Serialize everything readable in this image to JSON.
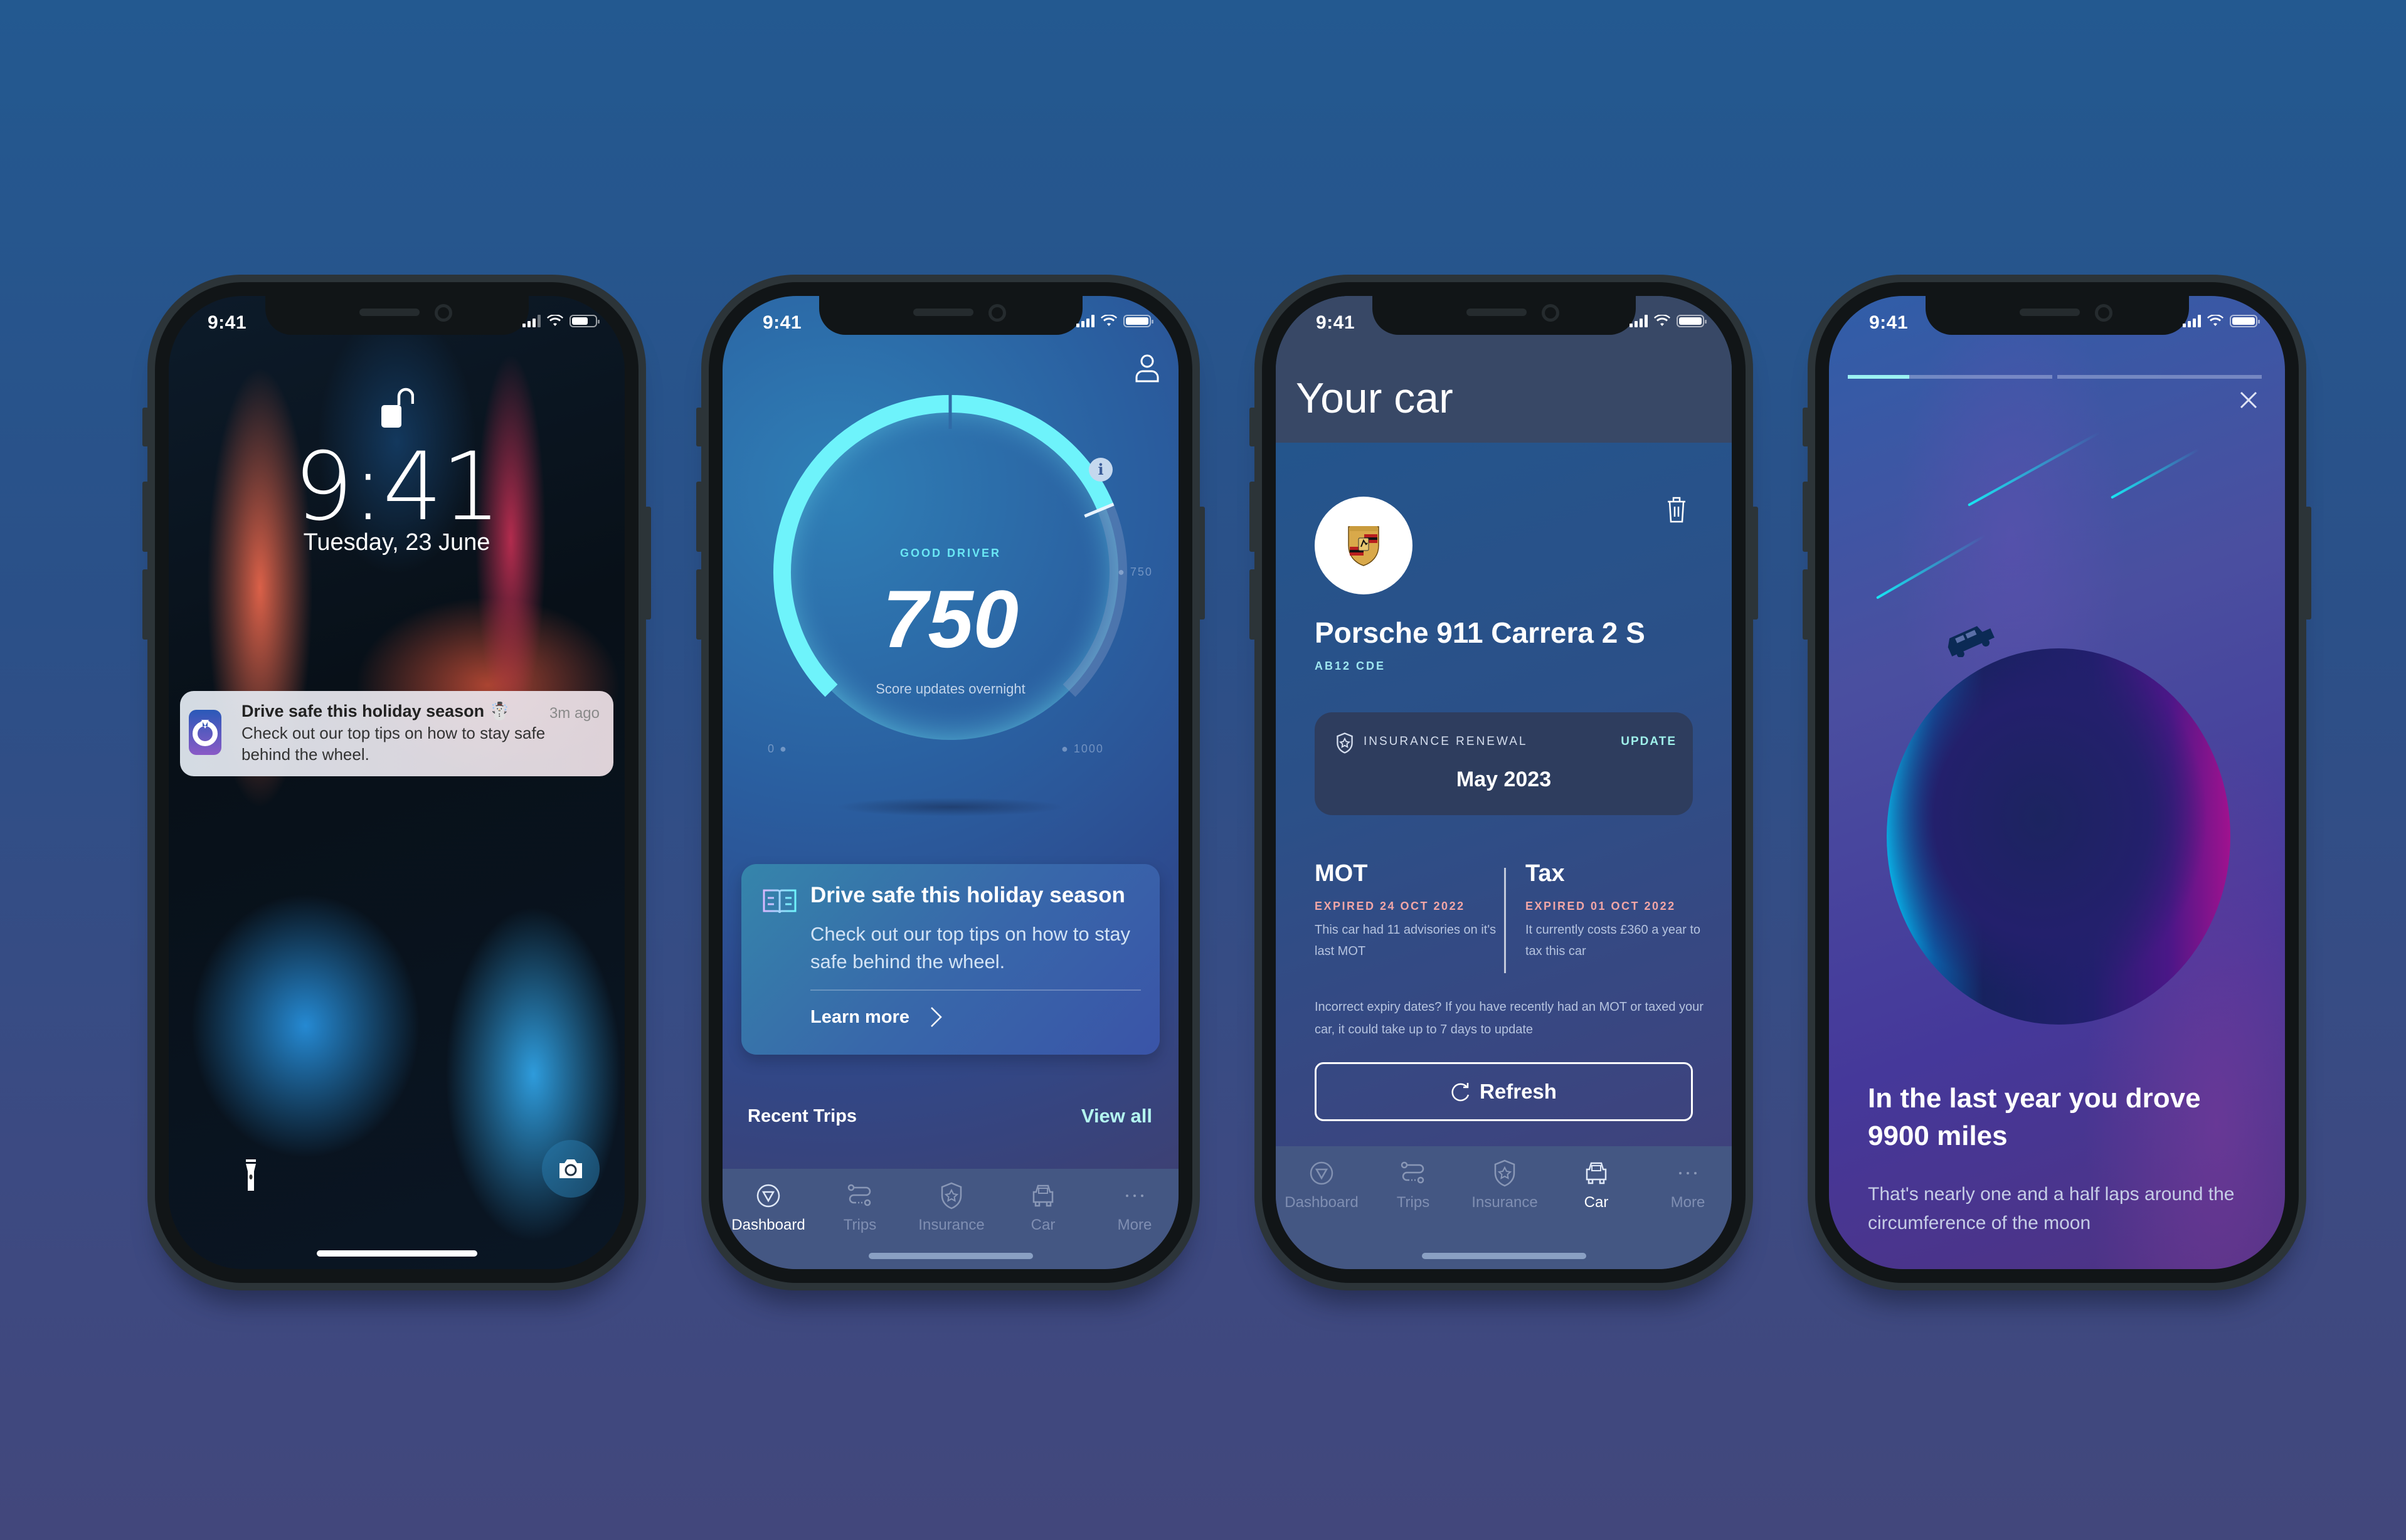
{
  "status_bar": {
    "time": "9:41"
  },
  "lock_screen": {
    "time": "9:41",
    "date": "Tuesday, 23 June",
    "notification": {
      "title": "Drive safe this holiday season ☃️",
      "time_ago": "3m ago",
      "body": "Check out our top tips on how to stay safe behind the wheel."
    },
    "icons": [
      "unlock-icon",
      "flashlight-icon",
      "camera-icon"
    ]
  },
  "dashboard": {
    "score_label": "GOOD DRIVER",
    "score": "750",
    "score_sub": "Score updates overnight",
    "gauge": {
      "min": 0,
      "max": 1000,
      "value": 750,
      "min_label": "0",
      "max_label": "1000",
      "value_label": "750"
    },
    "tip_card": {
      "title": "Drive safe this holiday season",
      "body": "Check out our top tips on how to stay safe behind the wheel.",
      "link": "Learn more"
    },
    "recent_trips": "Recent Trips",
    "view_all": "View all",
    "accent": "#6ef3fb"
  },
  "tabs": [
    {
      "label": "Dashboard",
      "icon": "dashboard-icon"
    },
    {
      "label": "Trips",
      "icon": "trips-icon"
    },
    {
      "label": "Insurance",
      "icon": "insurance-icon"
    },
    {
      "label": "Car",
      "icon": "car-icon"
    },
    {
      "label": "More",
      "icon": "more-icon"
    }
  ],
  "car": {
    "page_title": "Your car",
    "name": "Porsche 911 Carrera 2 S",
    "plate": "AB12 CDE",
    "insurance": {
      "label": "INSURANCE RENEWAL",
      "action": "UPDATE",
      "date": "May 2023"
    },
    "mot": {
      "title": "MOT",
      "status": "EXPIRED 24 OCT 2022",
      "desc": "This car had 11 advisories on it's last MOT"
    },
    "tax": {
      "title": "Tax",
      "status": "EXPIRED 01 OCT 2022",
      "desc": "It currently costs £360 a year to tax this car"
    },
    "note": "Incorrect expiry dates? If you have recently had an MOT or taxed your car, it could take up to 7 days to update",
    "refresh_label": "Refresh",
    "expired_color": "#f2a6a6"
  },
  "story": {
    "progress": [
      0.3,
      0
    ],
    "title": "In the last year you drove 9900 miles",
    "subtitle": "That's nearly one and a half laps around the circumference of the moon"
  }
}
